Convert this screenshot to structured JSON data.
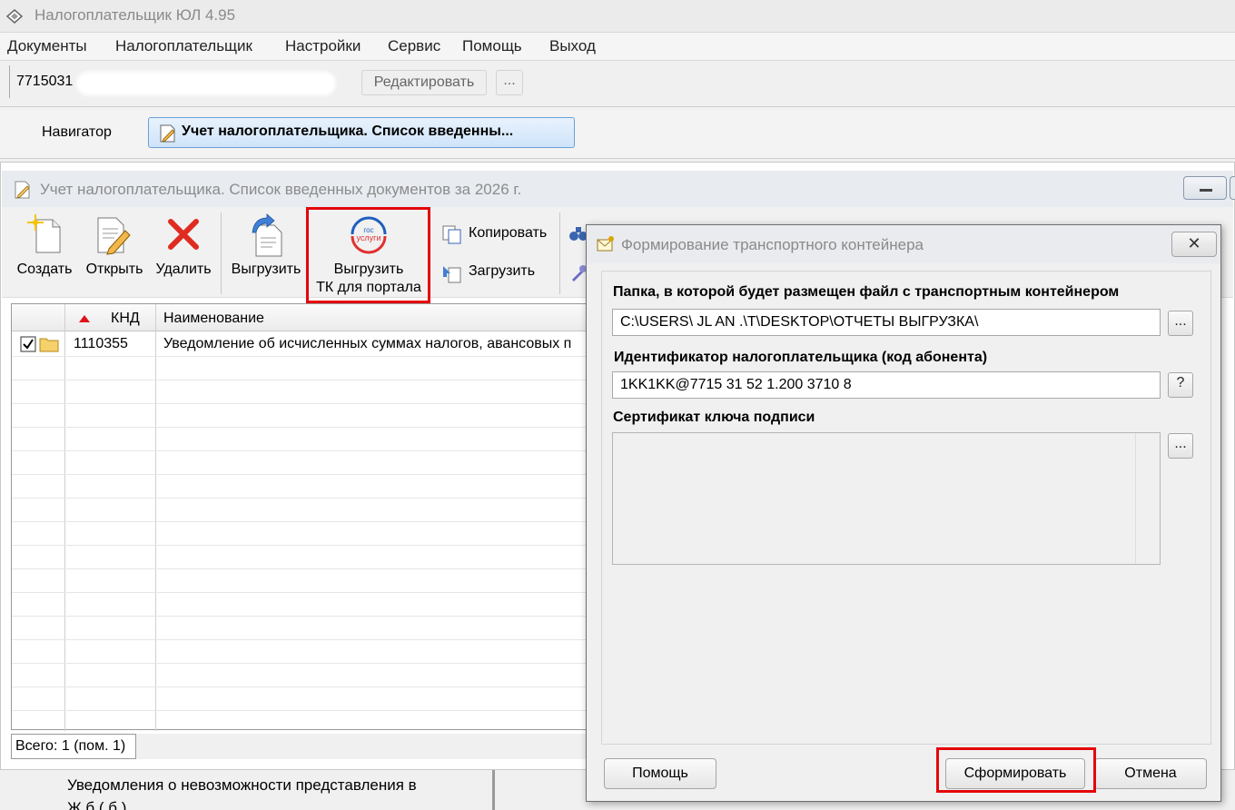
{
  "app": {
    "title": "Налогоплательщик ЮЛ 4.95"
  },
  "menu": [
    "Документы",
    "Налогоплательщик",
    "Настройки",
    "Сервис",
    "Помощь",
    "Выход"
  ],
  "taxpayer_bar": {
    "inn": "7715031",
    "edit_label": "Редактировать",
    "dots_label": "..."
  },
  "navigator": {
    "label": "Навигатор",
    "tab_label": "Учет налогоплательщика. Список введенны..."
  },
  "doc_window": {
    "title": "Учет налогоплательщика. Список введенных документов за 2026 г."
  },
  "toolbar": {
    "create": "Создать",
    "open": "Открыть",
    "delete": "Удалить",
    "export": "Выгрузить",
    "export_tk_line1": "Выгрузить",
    "export_tk_line2": "ТК для портала",
    "gosuslugi_logo_line1": "гос",
    "gosuslugi_logo_line2": "услуги",
    "copy": "Копировать",
    "load": "Загрузить"
  },
  "grid": {
    "columns": [
      "",
      "КНД",
      "Наименование"
    ],
    "rows": [
      {
        "checked": true,
        "knd": "1110355",
        "name": "Уведомление об исчисленных суммах налогов, авансовых п"
      }
    ]
  },
  "status": {
    "total": "Всего: 1 (пом. 1)"
  },
  "behind": {
    "line1": "Уведомления о невозможности представления в",
    "line2": "Ж       б (                     б )"
  },
  "dialog": {
    "title": "Формирование транспортного контейнера",
    "close_symbol": "✕",
    "folder_label": "Папка, в которой будет размещен файл с транспортным контейнером",
    "folder_value": "C:\\USERS\\  JL AN  .\\T\\DESKTOP\\ОТЧЕТЫ ВЫГРУЗКА\\",
    "folder_btn": "...",
    "id_label": "Идентификатор налогоплательщика (код абонента)",
    "id_value": "1KK1KK@7715  31  52  1.200  3710  8",
    "id_btn": "?",
    "cert_label": "Сертификат ключа подписи",
    "cert_btn": "...",
    "help_btn": "Помощь",
    "form_btn": "Сформировать",
    "cancel_btn": "Отмена"
  },
  "colors": {
    "highlight_red": "#e3070b",
    "tab_blue": "#cfe4fa"
  }
}
